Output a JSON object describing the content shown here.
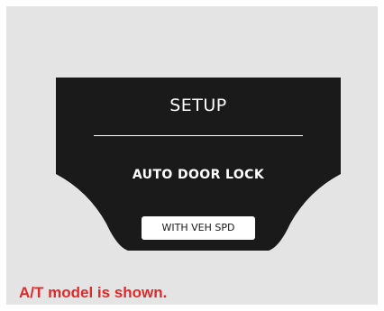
{
  "display": {
    "title": "SETUP",
    "setting_name": "AUTO DOOR LOCK",
    "option_label": "WITH VEH SPD"
  },
  "caption": "A/T model is shown.",
  "colors": {
    "background": "#e4e4e5",
    "screen": "#1a1a1a",
    "text_on_screen": "#ffffff",
    "caption": "#e02a2a"
  }
}
